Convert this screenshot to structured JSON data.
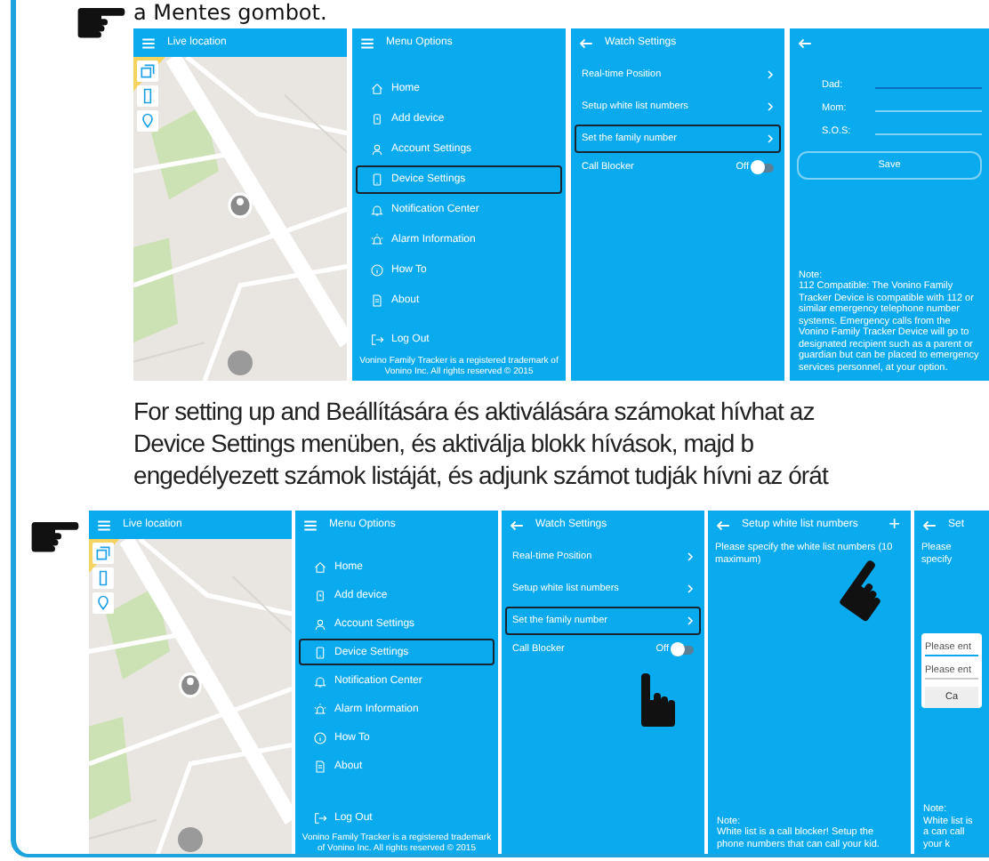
{
  "intro_text": "a Mentes gombot.",
  "screens_top": [
    {
      "kind": "map",
      "title": "Live location"
    },
    {
      "kind": "menu",
      "title": "Menu Options",
      "items": [
        {
          "label": "Home",
          "selected": false
        },
        {
          "label": "Add device",
          "selected": false
        },
        {
          "label": "Account Settings",
          "selected": false
        },
        {
          "label": "Device Settings",
          "selected": true
        },
        {
          "label": "Notification Center",
          "selected": false
        },
        {
          "label": "Alarm Information",
          "selected": false
        },
        {
          "label": "How To",
          "selected": false
        },
        {
          "label": "About",
          "selected": false
        }
      ],
      "logout": "Log Out",
      "footer": "Vonino Family Tracker is a registered trademark of Vonino Inc. All rights reserved © 2015"
    },
    {
      "kind": "settings",
      "title": "Watch Settings",
      "pointer": false,
      "rows": [
        {
          "label": "Real-time Position",
          "selected": false
        },
        {
          "label": "Setup white list numbers",
          "selected": false
        },
        {
          "label": "Set the family number",
          "selected": true
        }
      ],
      "switch": {
        "label": "Call Blocker",
        "state_text": "Off",
        "on": false
      }
    },
    {
      "kind": "contacts",
      "fields": [
        {
          "label": "Dad:",
          "focused": true
        },
        {
          "label": "Mom:",
          "focused": false
        },
        {
          "label": "S.O.S:",
          "focused": false
        }
      ],
      "button": "Save",
      "note": {
        "title": "Note:",
        "text": "112 Compatible: The Vonino Family Tracker Device is compatible with 112 or similar emergency telephone number systems. Emergency calls from the Vonino Family Tracker Device will go to designated recipient such as a parent or guardian but can be placed to emergency services personnel, at your option."
      }
    }
  ],
  "paragraph_lines": [
    "For setting up and Beállítására és aktiválására számokat hívhat az",
    "Device Settings menüben, és aktiválja blokk hívások, majd b",
    "engedélyezett számok listáját, és adjunk számot tudják hívni az órát"
  ],
  "screens_bottom": [
    {
      "kind": "map",
      "title": "Live location"
    },
    {
      "kind": "menu",
      "title": "Menu Options",
      "items": [
        {
          "label": "Home",
          "selected": false
        },
        {
          "label": "Add device",
          "selected": false
        },
        {
          "label": "Account Settings",
          "selected": false
        },
        {
          "label": "Device Settings",
          "selected": true
        },
        {
          "label": "Notification Center",
          "selected": false
        },
        {
          "label": "Alarm Information",
          "selected": false
        },
        {
          "label": "How To",
          "selected": false
        },
        {
          "label": "About",
          "selected": false
        }
      ],
      "logout": "Log Out",
      "footer": "Vonino Family Tracker is a registered trademark of Vonino Inc. All rights reserved © 2015"
    },
    {
      "kind": "settings",
      "title": "Watch Settings",
      "pointer": true,
      "rows": [
        {
          "label": "Real-time Position",
          "selected": false
        },
        {
          "label": "Setup white list numbers",
          "selected": false
        },
        {
          "label": "Set the family number",
          "selected": true
        }
      ],
      "switch": {
        "label": "Call Blocker",
        "state_text": "Off",
        "on": false
      }
    },
    {
      "kind": "whitelist",
      "title": "Setup white list numbers",
      "add_button": "+",
      "pointer": true,
      "hint": "Please specify the white list numbers (10 maximum)",
      "note": {
        "title": "Note:",
        "text": "White list is a call blocker! Setup the phone numbers that can call your kid."
      }
    },
    {
      "kind": "dialog",
      "title": "Set",
      "hint": "Please specify",
      "inputs": [
        {
          "placeholder": "Please ent",
          "focused": true
        },
        {
          "placeholder": "Please ent",
          "focused": false
        }
      ],
      "button": "Ca",
      "note": {
        "title": "Note:",
        "text": "White list is a can call your k"
      }
    }
  ]
}
